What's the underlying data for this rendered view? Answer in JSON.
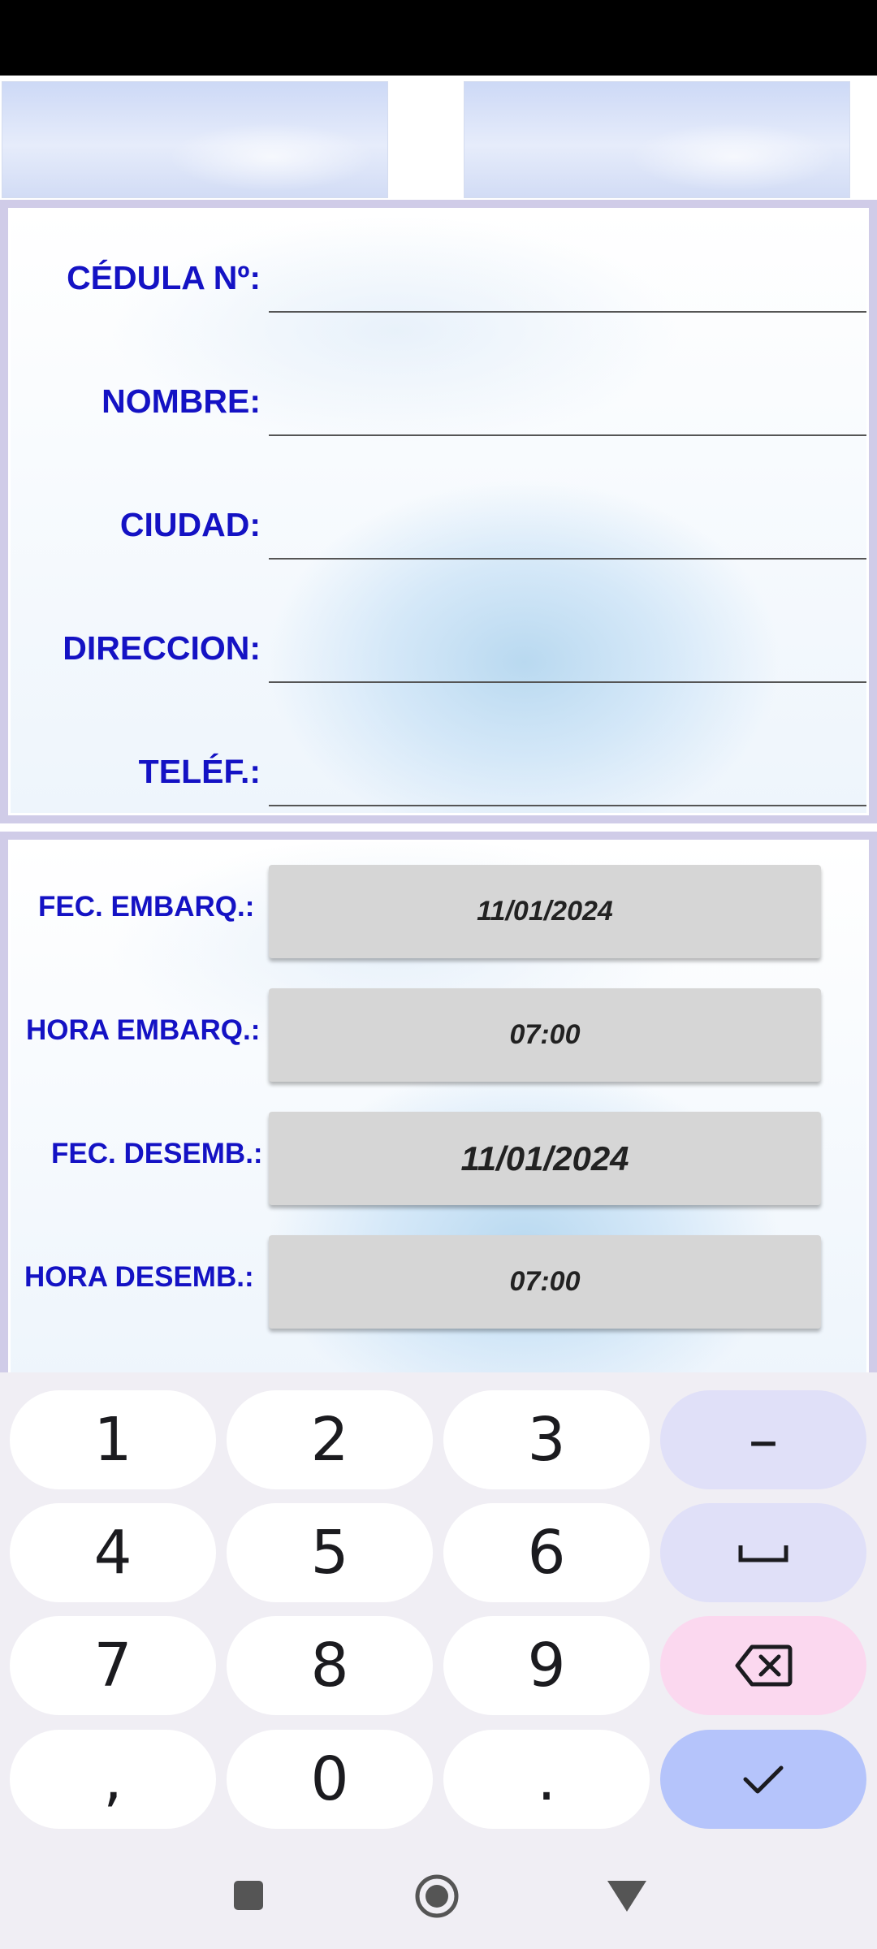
{
  "form": {
    "cedula_label": "CÉDULA Nº:",
    "nombre_label": "NOMBRE:",
    "ciudad_label": "CIUDAD:",
    "direccion_label": "DIRECCION:",
    "telefono_label": "TELÉF.:",
    "cedula_value": "",
    "nombre_value": "",
    "ciudad_value": "",
    "direccion_value": "",
    "telefono_value": ""
  },
  "schedule": {
    "fec_embarq_label": "FEC. EMBARQ.:",
    "fec_embarq_value": "11/01/2024",
    "hora_embarq_label": "HORA EMBARQ.:",
    "hora_embarq_value": "07:00",
    "fec_desemb_label": "FEC. DESEMB.:",
    "fec_desemb_value": "11/01/2024",
    "hora_desemb_label": "HORA DESEMB.:",
    "hora_desemb_value": "07:00"
  },
  "keyboard": {
    "k1": "1",
    "k2": "2",
    "k3": "3",
    "minus": "–",
    "k4": "4",
    "k5": "5",
    "k6": "6",
    "k7": "7",
    "k8": "8",
    "k9": "9",
    "comma": ",",
    "k0": "0",
    "period": ".",
    "space_icon": "space-icon",
    "backspace_icon": "backspace-icon",
    "done_icon": "check-icon"
  },
  "colors": {
    "label_blue": "#1412c4",
    "button_gray": "#d6d6d6",
    "done_key": "#b5c4fb",
    "delete_key": "#fbd8ef"
  }
}
